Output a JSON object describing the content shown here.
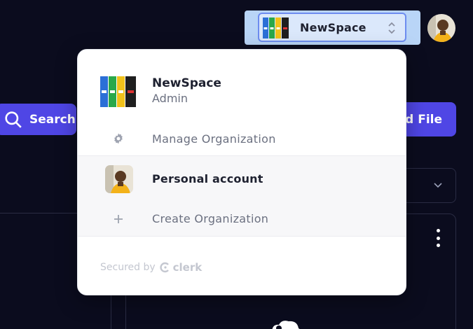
{
  "toolbar": {
    "search_label": "Search",
    "upload_label": "ad File"
  },
  "org_switcher": {
    "current_org": "NewSpace"
  },
  "popover": {
    "org_name": "NewSpace",
    "org_role": "Admin",
    "manage_label": "Manage Organization",
    "personal_label": "Personal account",
    "create_label": "Create Organization",
    "footer_prefix": "Secured by",
    "footer_brand": "clerk"
  },
  "icons": {
    "search": "search-icon",
    "gear": "gear-icon",
    "plus": "plus-icon",
    "updown": "chevron-updown-icon",
    "chevron_down": "chevron-down-icon",
    "kebab": "kebab-menu-icon",
    "clerk": "clerk-logo-icon"
  },
  "colors": {
    "accent": "#4f46e5",
    "background": "#0b0c1e",
    "switcher_highlight": "#b9d5f7"
  }
}
